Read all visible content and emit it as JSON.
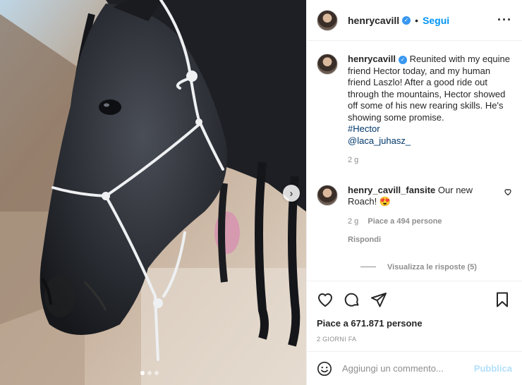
{
  "post": {
    "media": {
      "carousel": {
        "count": 3,
        "active_index": 0
      },
      "next_icon": "chevron-right-icon"
    },
    "header": {
      "username": "henrycavill",
      "separator": "•",
      "follow_label": "Segui",
      "more_icon": "more-options-icon"
    },
    "caption": {
      "username": "henrycavill",
      "text": "Reunited with my equine friend Hector today, and my human friend Laszlo! After a good ride out through the mountains, Hector showed off some of his new rearing skills. He's showing some promise.",
      "hashtag": "#Hector",
      "mention": "@laca_juhasz_",
      "age": "2 g"
    },
    "comments": [
      {
        "username": "henry_cavill_fansite",
        "text": "Our new Roach! 😍",
        "age": "2 g",
        "likes": "Piace a 494 persone",
        "reply_label": "Rispondi",
        "view_replies": "Visualizza le risposte (5)"
      }
    ],
    "actions": {
      "like_icon": "heart-icon",
      "comment_icon": "comment-icon",
      "share_icon": "share-icon",
      "save_icon": "bookmark-icon"
    },
    "likes_text": "Piace a 671.871 persone",
    "timestamp": "2 GIORNI FA",
    "add_comment": {
      "placeholder": "Aggiungi un commento...",
      "publish_label": "Pubblica",
      "emoji_icon": "emoji-icon"
    },
    "colors": {
      "link_blue": "#0095f6",
      "hashtag": "#00376b",
      "muted": "#8e8e8e",
      "publish_disabled": "#b2dffc",
      "verified_badge": "#3897f0"
    }
  }
}
